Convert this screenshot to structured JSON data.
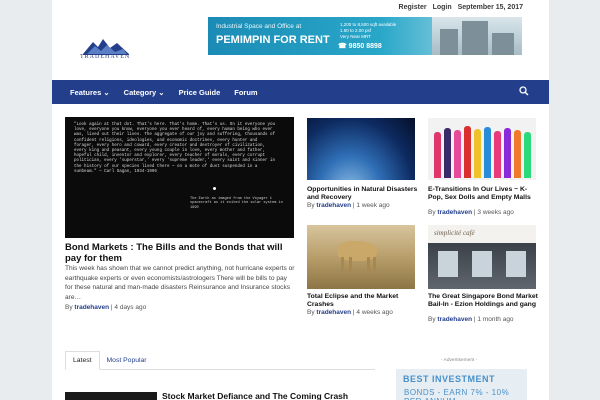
{
  "topbar": {
    "register": "Register",
    "login": "Login",
    "date": "September 15, 2017"
  },
  "logo": {
    "text": "TRADEHAVEN"
  },
  "ad_banner": {
    "line1": "Industrial Space and Office at",
    "headline": "PEMIMPIN FOR RENT",
    "details": [
      "1,200 to 8,500 sqft available",
      "1.80 to 2.00 psf",
      "Very Near MRT"
    ],
    "phone": "9850 8898"
  },
  "nav": {
    "items": [
      "Features",
      "Category",
      "Price Guide",
      "Forum"
    ],
    "dropdown_items": [
      "Features",
      "Category"
    ]
  },
  "featured": {
    "image_quote": "\"Look again at that dot. That's here. That's home. That's us. On it everyone you love, everyone you know, everyone you ever heard of, every human being who ever was, lived out their lives. The aggregate of our joy and suffering, thousands of confident religions, ideologies, and economic doctrines, every hunter and forager, every hero and coward, every creator and destroyer of civilization, every king and peasant, every young couple in love, every mother and father, hopeful child, inventor and explorer, every teacher of morals, every corrupt politician, every 'superstar,' every 'supreme leader,' every saint and sinner in the history of our species lived there — on a mote of dust suspended in a sunbeam.\" — Carl Sagan, 1934-1996",
    "image_caption": "The Earth as imaged from the Voyager 1 spacecraft as it exited the solar system in 1990",
    "title": "Bond Markets : The Bills and the Bonds that will pay for them",
    "excerpt": "This week has shown that we cannot predict anything, not hurricane experts or earthquake experts or even economists/astrologers There will be bills to pay for these natural and man-made disasters Reinsurance and Insurance stocks are…",
    "by": "By",
    "author": "tradehaven",
    "time": "4 days ago"
  },
  "cards": [
    {
      "title": "Opportunities in Natural Disasters and Recovery",
      "by": "By",
      "author": "tradehaven",
      "time": "1 week ago"
    },
    {
      "title": "E-Transitions In Our Lives ~ K-Pop, Sex Dolls and Empty Malls",
      "by": "By",
      "author": "tradehaven",
      "time": "3 weeks ago"
    },
    {
      "title": "Total Eclipse and the Market Crashes",
      "by": "By",
      "author": "tradehaven",
      "time": "4 weeks ago"
    },
    {
      "title": "The Great Singapore Bond Market Bail-In - Ezion Holdings and gang",
      "by": "By",
      "author": "tradehaven",
      "time": "1 month ago"
    }
  ],
  "card4_sign": "simplicité café",
  "tabs": [
    "Latest",
    "Most Popular"
  ],
  "sidebar": {
    "ad_label": "- Advertisement -",
    "ad_line1": "BEST INVESTMENT",
    "ad_line2": "BONDS - EARN 7% - 10% PER ANNUM"
  },
  "latest": {
    "title": "Stock Market Defiance and The Coming Crash"
  },
  "colors": {
    "nav": "#233f8c",
    "link": "#233f8c",
    "banner": "#1b8bb5"
  }
}
